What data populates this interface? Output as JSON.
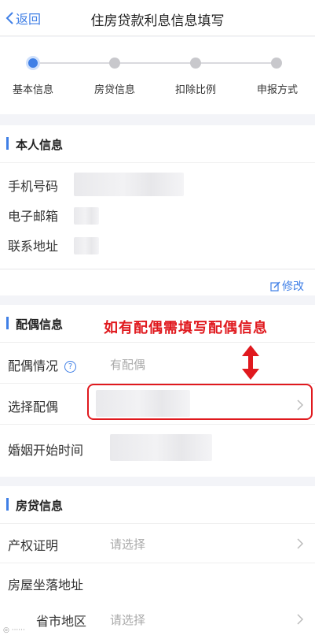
{
  "nav": {
    "back_label": "返回",
    "title": "住房贷款利息信息填写"
  },
  "steps": [
    {
      "label": "基本信息",
      "active": true
    },
    {
      "label": "房贷信息",
      "active": false
    },
    {
      "label": "扣除比例",
      "active": false
    },
    {
      "label": "申报方式",
      "active": false
    }
  ],
  "personal": {
    "title": "本人信息",
    "rows": [
      {
        "label": "手机号码"
      },
      {
        "label": "电子邮箱"
      },
      {
        "label": "联系地址"
      }
    ],
    "edit_label": "修改"
  },
  "spouse": {
    "title": "配偶信息",
    "status_label": "配偶情况",
    "status_value": "有配偶",
    "select_label": "选择配偶",
    "marriage_label": "婚姻开始时间"
  },
  "annotation": "如有配偶需填写配偶信息",
  "loan": {
    "title": "房贷信息",
    "cert_label": "产权证明",
    "cert_placeholder": "请选择",
    "address_label": "房屋坐落地址",
    "region_label": "省市地区",
    "region_placeholder": "请选择"
  },
  "colors": {
    "accent": "#3f7fe6",
    "annotation": "#e0191e"
  }
}
